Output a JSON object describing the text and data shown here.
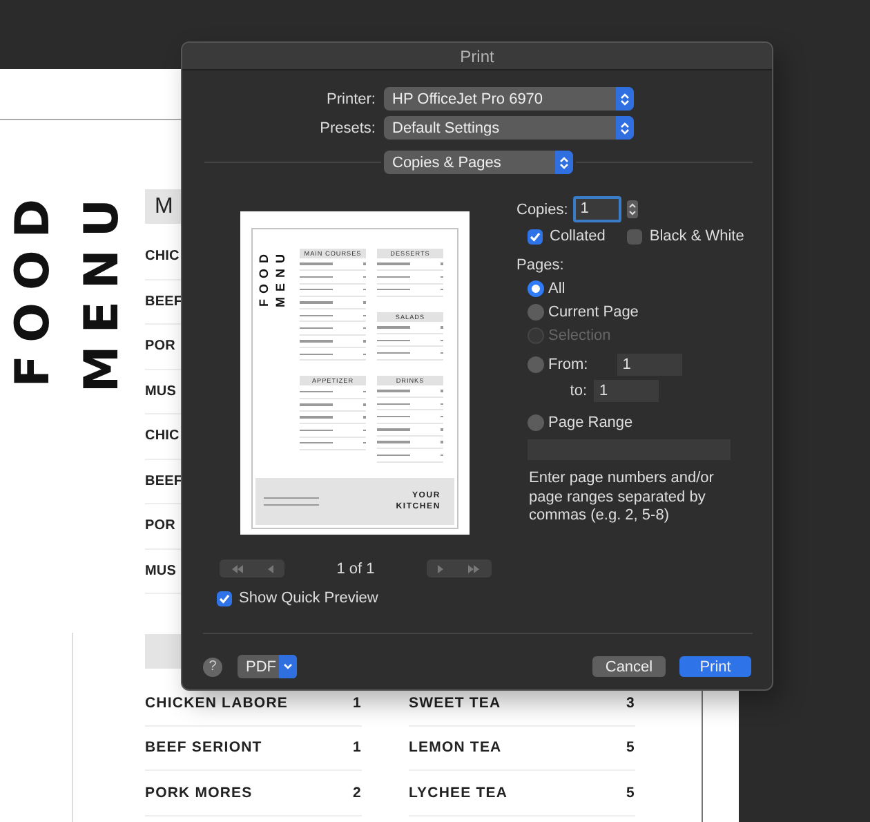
{
  "background_document": {
    "title_lines": [
      "FOOD",
      "MENU"
    ],
    "section_header": "M",
    "items": [
      "CHIC",
      "BEEF",
      "POR",
      "MUS",
      "CHIC",
      "BEEF",
      "POR",
      "MUS"
    ],
    "lower_rows": [
      {
        "name": "CHICKEN LABORE",
        "price": "1",
        "drink": "SWEET TEA",
        "drink_price": "3"
      },
      {
        "name": "BEEF SERIONT",
        "price": "1",
        "drink": "LEMON TEA",
        "drink_price": "5"
      },
      {
        "name": "PORK MORES",
        "price": "2",
        "drink": "LYCHEE TEA",
        "drink_price": "5"
      }
    ]
  },
  "dialog": {
    "title": "Print",
    "printer": {
      "label": "Printer:",
      "value": "HP OfficeJet Pro 6970"
    },
    "presets": {
      "label": "Presets:",
      "value": "Default Settings"
    },
    "section_popup": "Copies & Pages",
    "preview": {
      "title_lines": [
        "FOOD",
        "MENU"
      ],
      "columns": [
        [
          {
            "heading": "MAIN COURSES"
          },
          {
            "heading": "APPETIZER"
          }
        ],
        [
          {
            "heading": "DESSERTS"
          },
          {
            "heading": "SALADS"
          },
          {
            "heading": "DRINKS"
          }
        ]
      ],
      "footer_lines": [
        "YOUR",
        "KITCHEN"
      ]
    },
    "page_nav": "1 of 1",
    "show_quick_preview": {
      "label": "Show Quick Preview",
      "checked": true
    },
    "copies": {
      "label": "Copies:",
      "value": "1"
    },
    "collated": {
      "label": "Collated",
      "checked": true
    },
    "black_white": {
      "label": "Black & White",
      "checked": false
    },
    "pages": {
      "label": "Pages:",
      "options": [
        {
          "kind": "plain",
          "label": "All",
          "selected": true,
          "disabled": false
        },
        {
          "kind": "plain",
          "label": "Current Page",
          "selected": false,
          "disabled": false
        },
        {
          "kind": "plain",
          "label": "Selection",
          "selected": false,
          "disabled": true
        },
        {
          "kind": "from",
          "label": "From:",
          "selected": false,
          "disabled": false,
          "value": "1",
          "to_label": "to:",
          "to_value": "1"
        },
        {
          "kind": "range",
          "label": "Page Range",
          "selected": false,
          "disabled": false,
          "hint": "Enter page numbers and/or page ranges separated by commas (e.g. 2, 5-8)"
        }
      ]
    },
    "buttons": {
      "help": "?",
      "pdf": "PDF",
      "cancel": "Cancel",
      "print": "Print"
    }
  }
}
